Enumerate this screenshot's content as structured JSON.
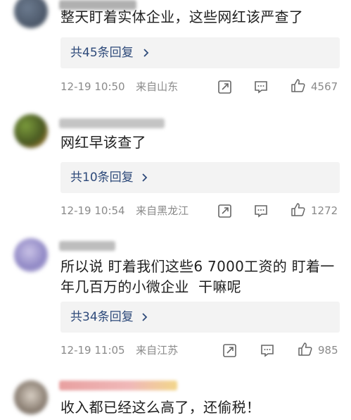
{
  "comments": [
    {
      "username": "",
      "text": "整天盯着实体企业，这些网红该严查了",
      "replies_label": "共45条回复",
      "date": "12-19 10:50",
      "location": "来自山东",
      "likes": "4567"
    },
    {
      "username": "",
      "text": "网红早该查了",
      "replies_label": "共10条回复",
      "date": "12-19 10:54",
      "location": "来自黑龙江",
      "likes": "1272"
    },
    {
      "username": "",
      "text_line1": "所以说 盯着我们这些6 7000工资的 盯着一",
      "text_line2": "年几百万的小微企业  干嘛呢",
      "replies_label": "共34条回复",
      "date": "12-19 11:05",
      "location": "来自江苏",
      "likes": "985"
    },
    {
      "username": "",
      "text": "收入都已经这么高了，还偷税！"
    }
  ],
  "icons": {
    "share": "share-icon",
    "comment": "comment-icon",
    "like": "thumbs-up-icon",
    "chevron": "chevron-right-icon"
  },
  "colors": {
    "reply_link": "#2e4a7a",
    "meta_text": "#8a8a8a",
    "reply_bg": "#f3f3f3"
  }
}
